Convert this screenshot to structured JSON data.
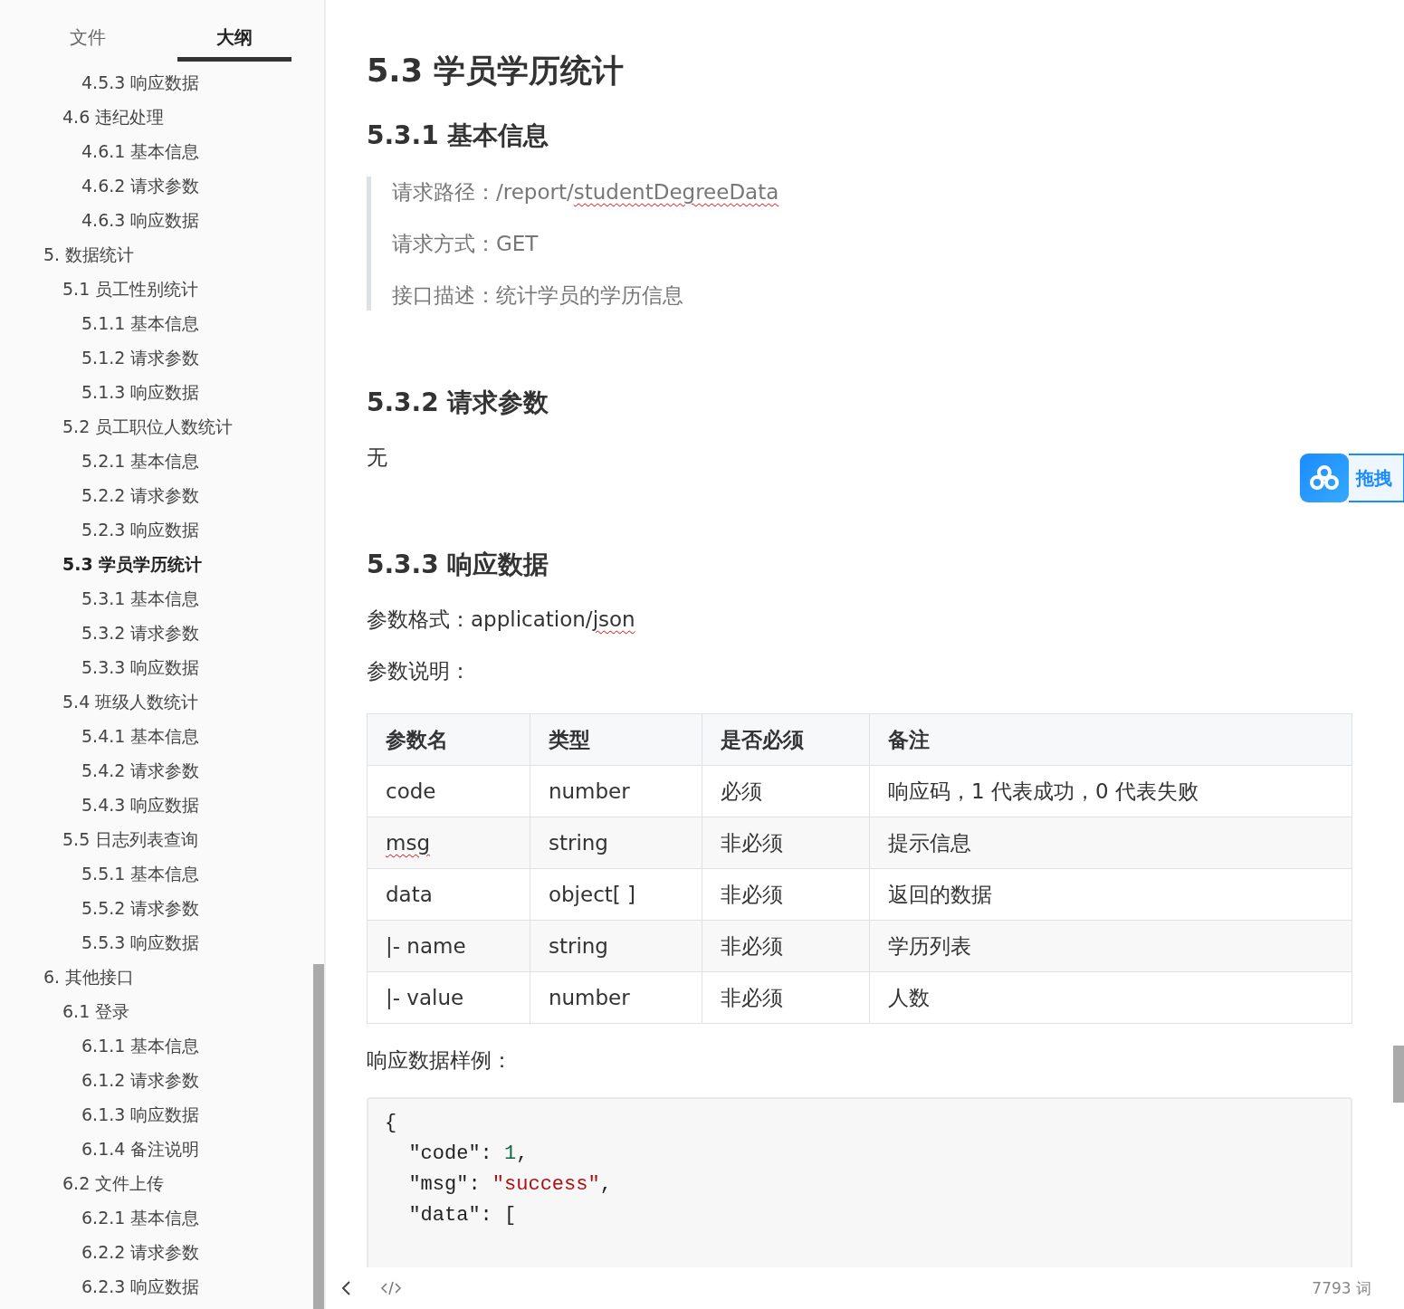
{
  "sidebar": {
    "tabs": [
      {
        "label": "文件",
        "selected": false
      },
      {
        "label": "大纲",
        "selected": true
      }
    ],
    "outline": [
      {
        "children": [
          {
            "children": [
              {
                "label": "4.5.3 响应数据",
                "selected": false
              }
            ]
          },
          {
            "label": "4.6 违纪处理",
            "selected": false,
            "children": [
              {
                "label": "4.6.1 基本信息",
                "selected": false
              },
              {
                "label": "4.6.2 请求参数",
                "selected": false
              },
              {
                "label": "4.6.3 响应数据",
                "selected": false
              }
            ]
          }
        ]
      },
      {
        "label": "5. 数据统计",
        "selected": false,
        "children": [
          {
            "label": "5.1 员工性别统计",
            "selected": false,
            "children": [
              {
                "label": "5.1.1 基本信息",
                "selected": false
              },
              {
                "label": "5.1.2 请求参数",
                "selected": false
              },
              {
                "label": "5.1.3 响应数据",
                "selected": false
              }
            ]
          },
          {
            "label": "5.2 员工职位人数统计",
            "selected": false,
            "children": [
              {
                "label": "5.2.1 基本信息",
                "selected": false
              },
              {
                "label": "5.2.2 请求参数",
                "selected": false
              },
              {
                "label": "5.2.3 响应数据",
                "selected": false
              }
            ]
          },
          {
            "label": "5.3 学员学历统计",
            "selected": true,
            "children": [
              {
                "label": "5.3.1 基本信息",
                "selected": false
              },
              {
                "label": "5.3.2 请求参数",
                "selected": false
              },
              {
                "label": "5.3.3 响应数据",
                "selected": false
              }
            ]
          },
          {
            "label": "5.4 班级人数统计",
            "selected": false,
            "children": [
              {
                "label": "5.4.1 基本信息",
                "selected": false
              },
              {
                "label": "5.4.2 请求参数",
                "selected": false
              },
              {
                "label": "5.4.3 响应数据",
                "selected": false
              }
            ]
          },
          {
            "label": "5.5 日志列表查询",
            "selected": false,
            "children": [
              {
                "label": "5.5.1 基本信息",
                "selected": false
              },
              {
                "label": "5.5.2 请求参数",
                "selected": false
              },
              {
                "label": "5.5.3 响应数据",
                "selected": false
              }
            ]
          }
        ]
      },
      {
        "label": "6. 其他接口",
        "selected": false,
        "children": [
          {
            "label": "6.1 登录",
            "selected": false,
            "children": [
              {
                "label": "6.1.1 基本信息",
                "selected": false
              },
              {
                "label": "6.1.2 请求参数",
                "selected": false
              },
              {
                "label": "6.1.3 响应数据",
                "selected": false
              },
              {
                "label": "6.1.4 备注说明",
                "selected": false
              }
            ]
          },
          {
            "label": "6.2 文件上传",
            "selected": false,
            "children": [
              {
                "label": "6.2.1 基本信息",
                "selected": false
              },
              {
                "label": "6.2.2 请求参数",
                "selected": false
              },
              {
                "label": "6.2.3 响应数据",
                "selected": false
              }
            ]
          }
        ]
      }
    ]
  },
  "document": {
    "blocks": [
      {
        "kind": "h1",
        "text": "5.3 学员学历统计"
      },
      {
        "kind": "h2",
        "text": "5.3.1 基本信息"
      },
      {
        "kind": "quote",
        "lines": [
          [
            {
              "text": "请求路径：/report/",
              "flagged": false
            },
            {
              "text": "studentDegreeData",
              "flagged": true
            }
          ],
          [
            {
              "text": "请求方式：GET",
              "flagged": false
            }
          ],
          [
            {
              "text": "接口描述：统计学员的学历信息",
              "flagged": false
            }
          ]
        ]
      },
      {
        "kind": "h2",
        "text": "5.3.2 请求参数"
      },
      {
        "kind": "p",
        "segments": [
          {
            "text": "无",
            "flagged": false
          }
        ]
      },
      {
        "kind": "h2",
        "text": "5.3.3 响应数据"
      },
      {
        "kind": "p",
        "segments": [
          {
            "text": "参数格式：application/",
            "flagged": false
          },
          {
            "text": "json",
            "flagged": true
          }
        ]
      },
      {
        "kind": "p",
        "segments": [
          {
            "text": "参数说明：",
            "flagged": false
          }
        ]
      },
      {
        "kind": "table",
        "columns": [
          "参数名",
          "类型",
          "是否必须",
          "备注"
        ],
        "rows": [
          [
            {
              "text": "code",
              "flagged": false
            },
            {
              "text": "number",
              "flagged": false
            },
            {
              "text": "必须",
              "flagged": false
            },
            {
              "text": "响应码，1 代表成功，0 代表失败",
              "flagged": false
            }
          ],
          [
            {
              "text": "msg",
              "flagged": true
            },
            {
              "text": "string",
              "flagged": false
            },
            {
              "text": "非必须",
              "flagged": false
            },
            {
              "text": "提示信息",
              "flagged": false
            }
          ],
          [
            {
              "text": "data",
              "flagged": false
            },
            {
              "text": "object[ ]",
              "flagged": false
            },
            {
              "text": "非必须",
              "flagged": false
            },
            {
              "text": "返回的数据",
              "flagged": false
            }
          ],
          [
            {
              "text": "|- name",
              "flagged": false
            },
            {
              "text": "string",
              "flagged": false
            },
            {
              "text": "非必须",
              "flagged": false
            },
            {
              "text": "学历列表",
              "flagged": false
            }
          ],
          [
            {
              "text": "|- value",
              "flagged": false
            },
            {
              "text": "number",
              "flagged": false
            },
            {
              "text": "非必须",
              "flagged": false
            },
            {
              "text": "人数",
              "flagged": false
            }
          ]
        ]
      },
      {
        "kind": "p",
        "segments": [
          {
            "text": "响应数据样例：",
            "flagged": false
          }
        ]
      },
      {
        "kind": "code",
        "lines": [
          [
            {
              "kind": "plain",
              "text": "{"
            }
          ],
          [
            {
              "kind": "plain",
              "text": "  \"code\": "
            },
            {
              "kind": "number",
              "text": "1"
            },
            {
              "kind": "plain",
              "text": ","
            }
          ],
          [
            {
              "kind": "plain",
              "text": "  \"msg\": "
            },
            {
              "kind": "string",
              "text": "\"success\""
            },
            {
              "kind": "plain",
              "text": ","
            }
          ],
          [
            {
              "kind": "plain",
              "text": "  \"data\": ["
            }
          ]
        ]
      }
    ]
  },
  "floating_badge": {
    "label": "拖拽"
  },
  "status_bar": {
    "word_count": "7793 词"
  }
}
